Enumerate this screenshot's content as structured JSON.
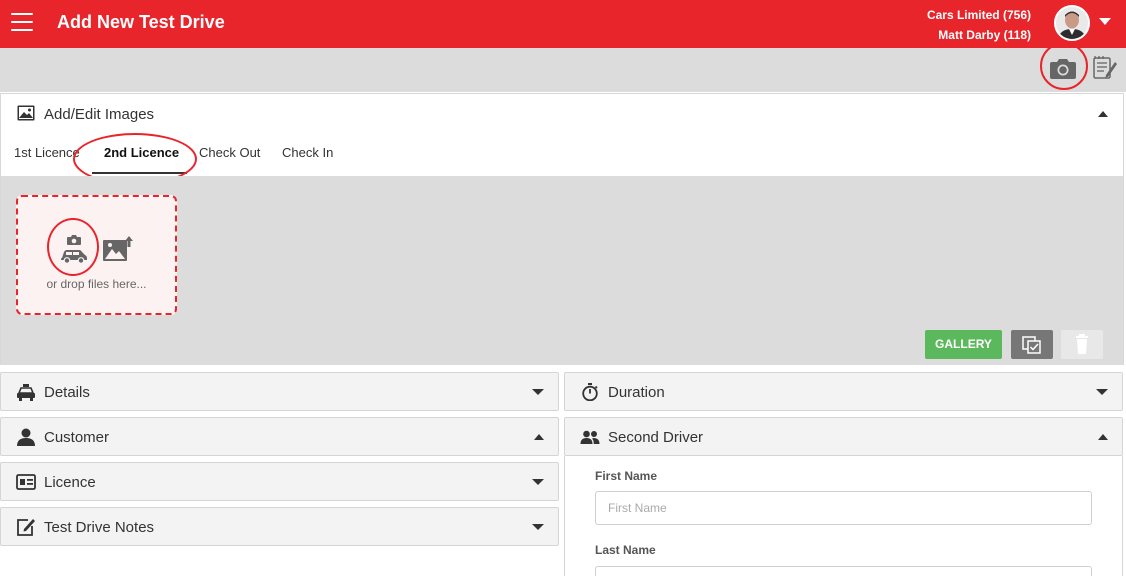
{
  "header": {
    "title": "Add New Test Drive",
    "company": "Cars Limited (756)",
    "user": "Matt Darby (118)"
  },
  "images_panel": {
    "title": "Add/Edit Images",
    "tabs": [
      {
        "label": "1st Licence"
      },
      {
        "label": "2nd Licence",
        "active": true
      },
      {
        "label": "Check Out"
      },
      {
        "label": "Check In"
      }
    ],
    "dropzone_text": "or drop files here...",
    "gallery_button": "GALLERY"
  },
  "sections": {
    "details": "Details",
    "duration": "Duration",
    "customer": "Customer",
    "second_driver": "Second Driver",
    "licence": "Licence",
    "notes": "Test Drive Notes"
  },
  "second_driver_form": {
    "first_name_label": "First Name",
    "first_name_placeholder": "First Name",
    "first_name_value": "",
    "last_name_label": "Last Name",
    "last_name_value": ""
  },
  "colors": {
    "brand_red": "#e8252b",
    "gallery_green": "#5cb85c",
    "toolbar_gray": "#dcdcdc"
  },
  "icons": [
    "menu-icon",
    "camera-icon",
    "notes-icon",
    "image-icon",
    "car-camera-icon",
    "upload-image-icon",
    "select-all-icon",
    "trash-icon",
    "taxi-icon",
    "stopwatch-icon",
    "person-icon",
    "people-icon",
    "id-card-icon",
    "edit-note-icon"
  ]
}
